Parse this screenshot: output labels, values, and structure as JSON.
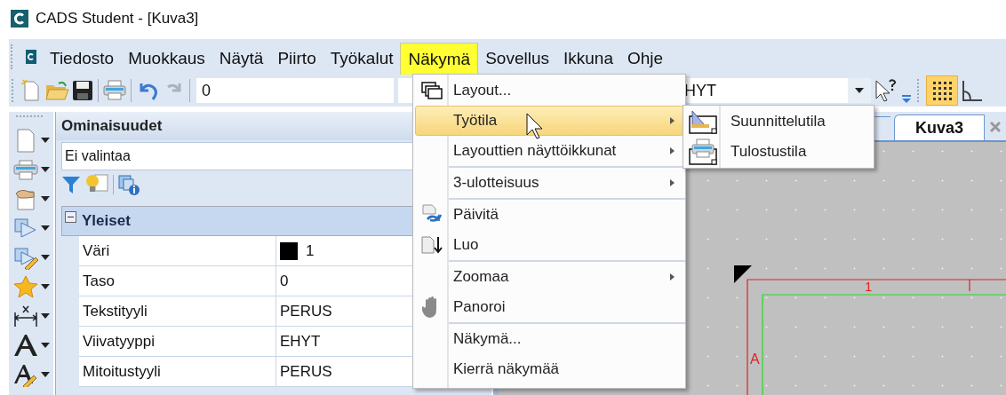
{
  "window": {
    "title": "CADS Student - [Kuva3]"
  },
  "menu_bar": [
    {
      "label": "Tiedosto",
      "selected": false
    },
    {
      "label": "Muokkaus",
      "selected": false
    },
    {
      "label": "Näytä",
      "selected": false
    },
    {
      "label": "Piirto",
      "selected": false
    },
    {
      "label": "Työkalut",
      "selected": false
    },
    {
      "label": "Näkymä",
      "selected": true
    },
    {
      "label": "Sovellus",
      "selected": false
    },
    {
      "label": "Ikkuna",
      "selected": false
    },
    {
      "label": "Ohje",
      "selected": false
    }
  ],
  "toolbar": {
    "layer_field": "0",
    "linetype_field": "HYT",
    "grid_on": true
  },
  "properties_panel": {
    "title": "Ominaisuudet",
    "selection": "Ei valintaa",
    "group": {
      "label": "Yleiset",
      "expanded": true,
      "rows": [
        {
          "name": "Väri",
          "value": "1",
          "color": "#000000"
        },
        {
          "name": "Taso",
          "value": "0"
        },
        {
          "name": "Tekstityyli",
          "value": "PERUS"
        },
        {
          "name": "Viivatyyppi",
          "value": "EHYT"
        },
        {
          "name": "Mitoitustyyli",
          "value": "PERUS"
        }
      ]
    }
  },
  "document_tabs": [
    {
      "label": "Kuva3",
      "selected": true
    }
  ],
  "drawing": {
    "column_label": "1",
    "row_label": "A"
  },
  "menu": {
    "items": [
      {
        "kind": "item",
        "label": "Layout...",
        "selected": false,
        "submenu": false
      },
      {
        "kind": "item",
        "label": "Työtila",
        "selected": true,
        "submenu": true
      },
      {
        "kind": "item",
        "label": "Layouttien näyttöikkunat",
        "selected": false,
        "submenu": true
      },
      {
        "kind": "separator"
      },
      {
        "kind": "item",
        "label": "3-ulotteisuus",
        "selected": false,
        "submenu": true
      },
      {
        "kind": "separator"
      },
      {
        "kind": "item",
        "label": "Päivitä",
        "selected": false,
        "submenu": false
      },
      {
        "kind": "item",
        "label": "Luo",
        "selected": false,
        "submenu": false
      },
      {
        "kind": "separator"
      },
      {
        "kind": "item",
        "label": "Zoomaa",
        "selected": false,
        "submenu": true
      },
      {
        "kind": "item",
        "label": "Panoroi",
        "selected": false,
        "submenu": false
      },
      {
        "kind": "separator"
      },
      {
        "kind": "item",
        "label": "Näkymä...",
        "selected": false,
        "submenu": false
      },
      {
        "kind": "item",
        "label": "Kierrä näkymää",
        "selected": false,
        "submenu": false
      }
    ]
  },
  "submenu": {
    "items": [
      {
        "label": "Suunnittelutila",
        "selected": false
      },
      {
        "label": "Tulostustila",
        "selected": false
      }
    ]
  }
}
